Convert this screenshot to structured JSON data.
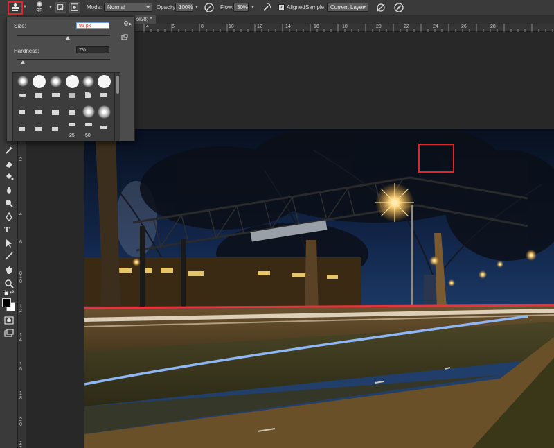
{
  "options_bar": {
    "brush_size": "95",
    "mode_label": "Mode:",
    "mode_value": "Normal",
    "opacity_label": "Opacity:",
    "opacity_value": "100%",
    "flow_label": "Flow:",
    "flow_value": "30%",
    "aligned_label": "Aligned",
    "sample_label": "Sample:",
    "sample_value": "Current Layer"
  },
  "document_tab": {
    "title": "sk/8) *"
  },
  "ruler": {
    "horizontal_ticks": [
      "4",
      "6",
      "8",
      "10",
      "12",
      "14",
      "16",
      "18",
      "20",
      "22",
      "24",
      "26",
      "28"
    ],
    "vertical_ticks": [
      "2",
      "4",
      "6",
      "8",
      "1 0",
      "1 2",
      "1 4",
      "1 6",
      "1 8",
      "2 0",
      "2 2"
    ]
  },
  "brush_picker": {
    "size_label": "Size:",
    "size_value": "95 px",
    "size_fraction": 0.55,
    "hardness_label": "Hardness:",
    "hardness_value": "7%",
    "hardness_fraction": 0.07,
    "tip_size_labels": [
      "25",
      "50"
    ]
  },
  "colors": {
    "highlight_red": "#e0272b",
    "foreground": "#000000",
    "background": "#ffffff"
  },
  "icons": [
    "clone-stamp-icon",
    "brush-panel-icon",
    "clone-source-icon",
    "airbrush-pressure-icon",
    "airbrush-flow-icon",
    "ignore-adjustment-layers-icon",
    "pressure-size-icon",
    "settings-gear-icon",
    "new-preset-icon"
  ]
}
